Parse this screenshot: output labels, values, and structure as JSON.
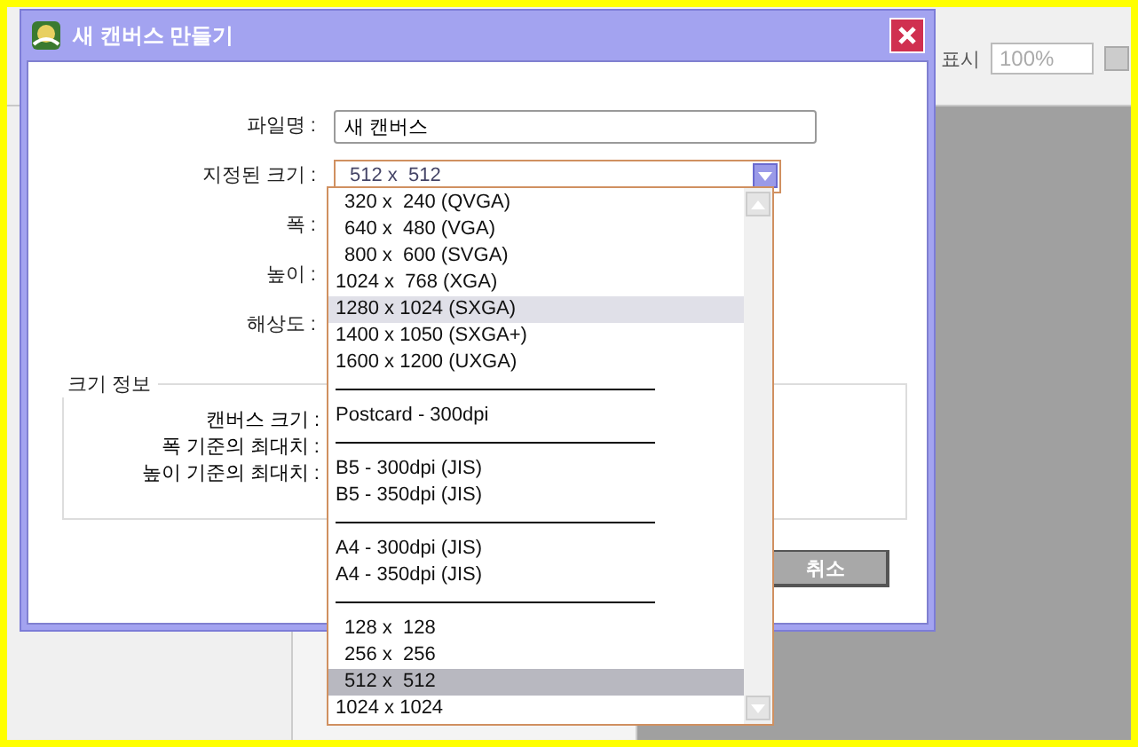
{
  "background_app": {
    "zoom_label": "표시",
    "zoom_value": "100%"
  },
  "dialog": {
    "title": "새 캔버스 만들기",
    "form": [
      {
        "kind": "field",
        "label": "파일명 :",
        "value": "새 캔버스"
      },
      {
        "kind": "select",
        "label": "지정된 크기 :",
        "value": "512 x  512"
      },
      {
        "kind": "label",
        "label": "폭 :"
      },
      {
        "kind": "label",
        "label": "높이 :"
      },
      {
        "kind": "label",
        "label": "해상도 :"
      }
    ],
    "size_info": {
      "title": "크기 정보",
      "rows": [
        "캔버스 크기 :",
        "폭 기준의 최대치 :",
        "높이 기준의 최대치 :"
      ]
    },
    "buttons": [
      "취소"
    ]
  },
  "dropdown": [
    {
      "kind": "item",
      "text": "320 x  240 (QVGA)",
      "indent": true,
      "hovered": false,
      "selected": false
    },
    {
      "kind": "item",
      "text": "640 x  480 (VGA)",
      "indent": true,
      "hovered": false,
      "selected": false
    },
    {
      "kind": "item",
      "text": "800 x  600 (SVGA)",
      "indent": true,
      "hovered": false,
      "selected": false
    },
    {
      "kind": "item",
      "text": "1024 x  768 (XGA)",
      "indent": false,
      "hovered": false,
      "selected": false
    },
    {
      "kind": "item",
      "text": "1280 x 1024 (SXGA)",
      "indent": false,
      "hovered": true,
      "selected": false
    },
    {
      "kind": "item",
      "text": "1400 x 1050 (SXGA+)",
      "indent": false,
      "hovered": false,
      "selected": false
    },
    {
      "kind": "item",
      "text": "1600 x 1200 (UXGA)",
      "indent": false,
      "hovered": false,
      "selected": false
    },
    {
      "kind": "separator"
    },
    {
      "kind": "item",
      "text": "Postcard - 300dpi",
      "indent": false,
      "hovered": false,
      "selected": false
    },
    {
      "kind": "separator"
    },
    {
      "kind": "item",
      "text": "B5 - 300dpi (JIS)",
      "indent": false,
      "hovered": false,
      "selected": false
    },
    {
      "kind": "item",
      "text": "B5 - 350dpi (JIS)",
      "indent": false,
      "hovered": false,
      "selected": false
    },
    {
      "kind": "separator"
    },
    {
      "kind": "item",
      "text": "A4 - 300dpi (JIS)",
      "indent": false,
      "hovered": false,
      "selected": false
    },
    {
      "kind": "item",
      "text": "A4 - 350dpi (JIS)",
      "indent": false,
      "hovered": false,
      "selected": false
    },
    {
      "kind": "separator"
    },
    {
      "kind": "item",
      "text": "128 x  128",
      "indent": true,
      "hovered": false,
      "selected": false
    },
    {
      "kind": "item",
      "text": "256 x  256",
      "indent": true,
      "hovered": false,
      "selected": false
    },
    {
      "kind": "item",
      "text": "512 x  512",
      "indent": true,
      "hovered": false,
      "selected": true
    },
    {
      "kind": "item",
      "text": "1024 x 1024",
      "indent": false,
      "hovered": false,
      "selected": false
    }
  ]
}
